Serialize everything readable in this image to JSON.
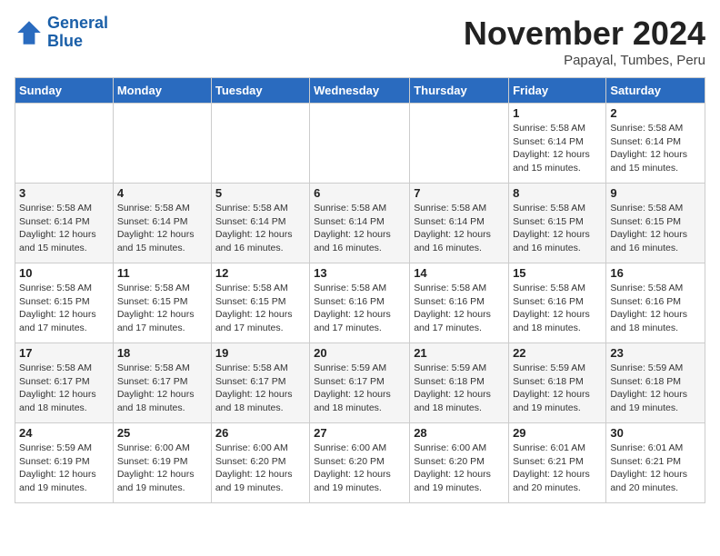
{
  "logo": {
    "line1": "General",
    "line2": "Blue"
  },
  "title": "November 2024",
  "location": "Papayal, Tumbes, Peru",
  "weekdays": [
    "Sunday",
    "Monday",
    "Tuesday",
    "Wednesday",
    "Thursday",
    "Friday",
    "Saturday"
  ],
  "weeks": [
    [
      {
        "day": "",
        "info": ""
      },
      {
        "day": "",
        "info": ""
      },
      {
        "day": "",
        "info": ""
      },
      {
        "day": "",
        "info": ""
      },
      {
        "day": "",
        "info": ""
      },
      {
        "day": "1",
        "info": "Sunrise: 5:58 AM\nSunset: 6:14 PM\nDaylight: 12 hours and 15 minutes."
      },
      {
        "day": "2",
        "info": "Sunrise: 5:58 AM\nSunset: 6:14 PM\nDaylight: 12 hours and 15 minutes."
      }
    ],
    [
      {
        "day": "3",
        "info": "Sunrise: 5:58 AM\nSunset: 6:14 PM\nDaylight: 12 hours and 15 minutes."
      },
      {
        "day": "4",
        "info": "Sunrise: 5:58 AM\nSunset: 6:14 PM\nDaylight: 12 hours and 15 minutes."
      },
      {
        "day": "5",
        "info": "Sunrise: 5:58 AM\nSunset: 6:14 PM\nDaylight: 12 hours and 16 minutes."
      },
      {
        "day": "6",
        "info": "Sunrise: 5:58 AM\nSunset: 6:14 PM\nDaylight: 12 hours and 16 minutes."
      },
      {
        "day": "7",
        "info": "Sunrise: 5:58 AM\nSunset: 6:14 PM\nDaylight: 12 hours and 16 minutes."
      },
      {
        "day": "8",
        "info": "Sunrise: 5:58 AM\nSunset: 6:15 PM\nDaylight: 12 hours and 16 minutes."
      },
      {
        "day": "9",
        "info": "Sunrise: 5:58 AM\nSunset: 6:15 PM\nDaylight: 12 hours and 16 minutes."
      }
    ],
    [
      {
        "day": "10",
        "info": "Sunrise: 5:58 AM\nSunset: 6:15 PM\nDaylight: 12 hours and 17 minutes."
      },
      {
        "day": "11",
        "info": "Sunrise: 5:58 AM\nSunset: 6:15 PM\nDaylight: 12 hours and 17 minutes."
      },
      {
        "day": "12",
        "info": "Sunrise: 5:58 AM\nSunset: 6:15 PM\nDaylight: 12 hours and 17 minutes."
      },
      {
        "day": "13",
        "info": "Sunrise: 5:58 AM\nSunset: 6:16 PM\nDaylight: 12 hours and 17 minutes."
      },
      {
        "day": "14",
        "info": "Sunrise: 5:58 AM\nSunset: 6:16 PM\nDaylight: 12 hours and 17 minutes."
      },
      {
        "day": "15",
        "info": "Sunrise: 5:58 AM\nSunset: 6:16 PM\nDaylight: 12 hours and 18 minutes."
      },
      {
        "day": "16",
        "info": "Sunrise: 5:58 AM\nSunset: 6:16 PM\nDaylight: 12 hours and 18 minutes."
      }
    ],
    [
      {
        "day": "17",
        "info": "Sunrise: 5:58 AM\nSunset: 6:17 PM\nDaylight: 12 hours and 18 minutes."
      },
      {
        "day": "18",
        "info": "Sunrise: 5:58 AM\nSunset: 6:17 PM\nDaylight: 12 hours and 18 minutes."
      },
      {
        "day": "19",
        "info": "Sunrise: 5:58 AM\nSunset: 6:17 PM\nDaylight: 12 hours and 18 minutes."
      },
      {
        "day": "20",
        "info": "Sunrise: 5:59 AM\nSunset: 6:17 PM\nDaylight: 12 hours and 18 minutes."
      },
      {
        "day": "21",
        "info": "Sunrise: 5:59 AM\nSunset: 6:18 PM\nDaylight: 12 hours and 18 minutes."
      },
      {
        "day": "22",
        "info": "Sunrise: 5:59 AM\nSunset: 6:18 PM\nDaylight: 12 hours and 19 minutes."
      },
      {
        "day": "23",
        "info": "Sunrise: 5:59 AM\nSunset: 6:18 PM\nDaylight: 12 hours and 19 minutes."
      }
    ],
    [
      {
        "day": "24",
        "info": "Sunrise: 5:59 AM\nSunset: 6:19 PM\nDaylight: 12 hours and 19 minutes."
      },
      {
        "day": "25",
        "info": "Sunrise: 6:00 AM\nSunset: 6:19 PM\nDaylight: 12 hours and 19 minutes."
      },
      {
        "day": "26",
        "info": "Sunrise: 6:00 AM\nSunset: 6:20 PM\nDaylight: 12 hours and 19 minutes."
      },
      {
        "day": "27",
        "info": "Sunrise: 6:00 AM\nSunset: 6:20 PM\nDaylight: 12 hours and 19 minutes."
      },
      {
        "day": "28",
        "info": "Sunrise: 6:00 AM\nSunset: 6:20 PM\nDaylight: 12 hours and 19 minutes."
      },
      {
        "day": "29",
        "info": "Sunrise: 6:01 AM\nSunset: 6:21 PM\nDaylight: 12 hours and 20 minutes."
      },
      {
        "day": "30",
        "info": "Sunrise: 6:01 AM\nSunset: 6:21 PM\nDaylight: 12 hours and 20 minutes."
      }
    ]
  ]
}
